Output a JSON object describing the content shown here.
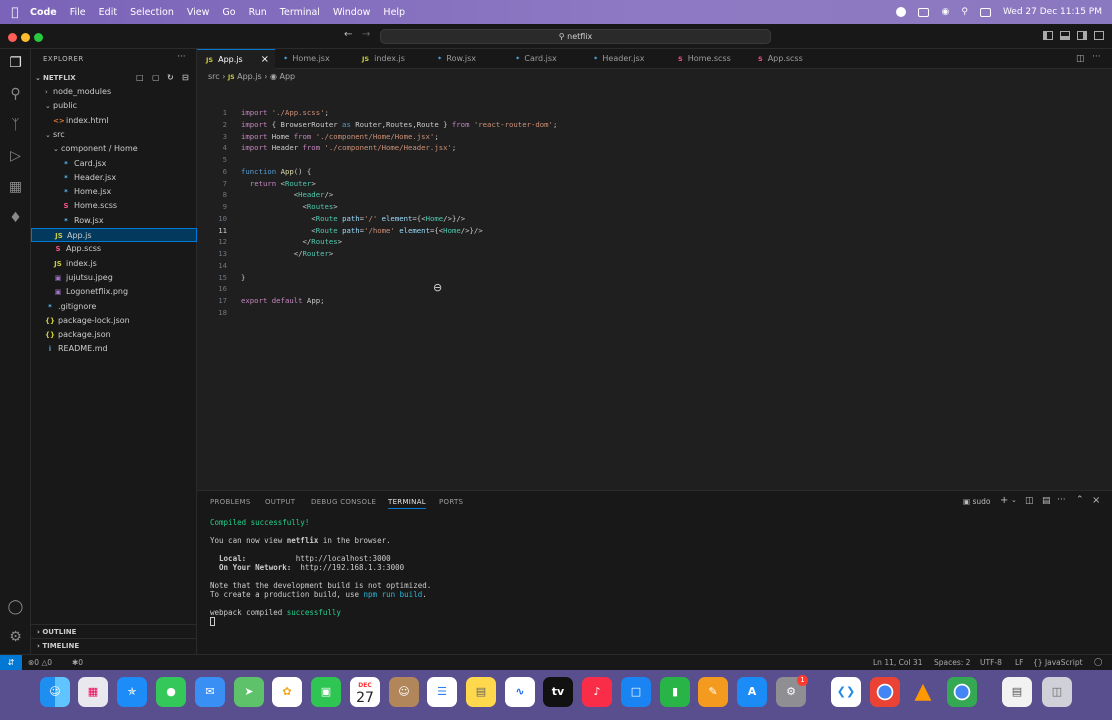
{
  "menubar": {
    "app": "Code",
    "items": [
      "File",
      "Edit",
      "Selection",
      "View",
      "Go",
      "Run",
      "Terminal",
      "Window",
      "Help"
    ],
    "clock": "Wed 27 Dec  11:15 PM"
  },
  "window": {
    "search": "netflix"
  },
  "explorer": {
    "title": "EXPLORER",
    "root": "NETFLIX",
    "tree": [
      {
        "name": "node_modules",
        "type": "folder",
        "depth": 1,
        "icon": ""
      },
      {
        "name": "public",
        "type": "folder",
        "depth": 1,
        "icon": ""
      },
      {
        "name": "index.html",
        "type": "file",
        "depth": 2,
        "icon": "<>"
      },
      {
        "name": "src",
        "type": "folder",
        "depth": 1,
        "icon": ""
      },
      {
        "name": "component / Home",
        "type": "folder",
        "depth": 2,
        "icon": ""
      },
      {
        "name": "Card.jsx",
        "type": "file",
        "depth": 3,
        "icon": "*"
      },
      {
        "name": "Header.jsx",
        "type": "file",
        "depth": 3,
        "icon": "*"
      },
      {
        "name": "Home.jsx",
        "type": "file",
        "depth": 3,
        "icon": "*"
      },
      {
        "name": "Home.scss",
        "type": "file",
        "depth": 3,
        "icon": "S"
      },
      {
        "name": "Row.jsx",
        "type": "file",
        "depth": 3,
        "icon": "*"
      },
      {
        "name": "App.js",
        "type": "file",
        "depth": 2,
        "icon": "JS"
      },
      {
        "name": "App.scss",
        "type": "file",
        "depth": 2,
        "icon": "S"
      },
      {
        "name": "index.js",
        "type": "file",
        "depth": 2,
        "icon": "JS"
      },
      {
        "name": "jujutsu.jpeg",
        "type": "file",
        "depth": 2,
        "icon": "img"
      },
      {
        "name": "Logonetflix.png",
        "type": "file",
        "depth": 2,
        "icon": "img"
      },
      {
        "name": ".gitignore",
        "type": "file",
        "depth": 1,
        "icon": "*"
      },
      {
        "name": "package-lock.json",
        "type": "file",
        "depth": 1,
        "icon": "{}"
      },
      {
        "name": "package.json",
        "type": "file",
        "depth": 1,
        "icon": "{}"
      },
      {
        "name": "README.md",
        "type": "file",
        "depth": 1,
        "icon": "i"
      }
    ],
    "selected": "App.js",
    "outline": "OUTLINE",
    "timeline": "TIMELINE"
  },
  "tabs": [
    {
      "label": "App.js",
      "icon": "JS",
      "active": true
    },
    {
      "label": "Home.jsx",
      "icon": "*",
      "active": false
    },
    {
      "label": "index.js",
      "icon": "JS",
      "active": false
    },
    {
      "label": "Row.jsx",
      "icon": "*",
      "active": false
    },
    {
      "label": "Card.jsx",
      "icon": "*",
      "active": false
    },
    {
      "label": "Header.jsx",
      "icon": "*",
      "active": false
    },
    {
      "label": "Home.scss",
      "icon": "S",
      "active": false
    },
    {
      "label": "App.scss",
      "icon": "S",
      "active": false
    }
  ],
  "breadcrumb": {
    "parts": [
      "src",
      "App.js",
      "App"
    ]
  },
  "editor": {
    "current_line": 11,
    "lines": [
      "import './App.scss';",
      "import { BrowserRouter as Router,Routes,Route } from 'react-router-dom';",
      "import Home from './component/Home/Home.jsx';",
      "import Header from './component/Home/Header.jsx';",
      "",
      "function App() {",
      "  return <Router>",
      "            <Header/>",
      "              <Routes>",
      "                <Route path='/' element={<Home/>}/>",
      "                <Route path='/home' element={<Home/>}/>",
      "              </Routes>",
      "            </Router>",
      "",
      "}",
      "",
      "export default App;",
      ""
    ]
  },
  "panel": {
    "tabs": [
      "PROBLEMS",
      "OUTPUT",
      "DEBUG CONSOLE",
      "TERMINAL",
      "PORTS"
    ],
    "active_tab": "TERMINAL",
    "shell": "sudo",
    "terminal": {
      "compiled": "Compiled successfully!",
      "view_pre": "You can now view ",
      "app_name": "netflix",
      "view_post": " in the browser.",
      "local_label": "  Local:",
      "local_url": "http://localhost:3000",
      "network_label": "  On Your Network:",
      "network_url": "http://192.168.1.3:3000",
      "note1": "Note that the development build is not optimized.",
      "note2_pre": "To create a production build, use ",
      "note2_cmd": "npm run build",
      "note2_post": ".",
      "webpack_pre": "webpack compiled ",
      "webpack_status": "successfully"
    }
  },
  "statusbar": {
    "errors": "0",
    "warnings": "0",
    "ports": "0",
    "position": "Ln 11, Col 31",
    "spaces": "Spaces: 2",
    "encoding": "UTF-8",
    "eol": "LF",
    "language": "JavaScript"
  },
  "dock": {
    "calendar_month": "DEC",
    "calendar_day": "27",
    "settings_badge": "1",
    "apps": [
      "finder-icon",
      "launchpad-icon",
      "safari-icon",
      "messages-icon",
      "mail-icon",
      "maps-icon",
      "photos-icon",
      "facetime-icon",
      "calendar-icon",
      "contacts-icon",
      "reminders-icon",
      "notes-icon",
      "freeform-icon",
      "appletv-icon",
      "music-icon",
      "keynote-icon",
      "numbers-icon",
      "pages-icon",
      "appstore-icon",
      "system-settings-icon",
      "vscode-icon",
      "chrome-icon",
      "vlc-icon",
      "chrome-alt-icon",
      "document-icon",
      "trash-icon"
    ]
  }
}
